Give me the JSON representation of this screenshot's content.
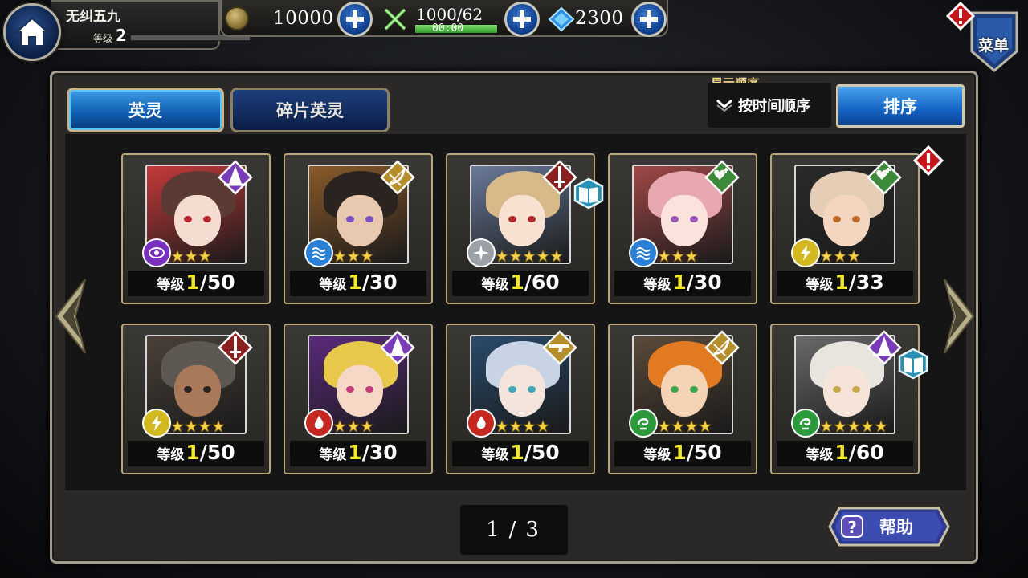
{
  "player": {
    "name": "无纠五九",
    "level_label": "等级",
    "level": "2"
  },
  "resources": {
    "coins": "10000",
    "stamina": "1000/62",
    "stamina_timer": "00:00",
    "gems": "2300"
  },
  "menu": {
    "label": "菜单"
  },
  "tabs": [
    {
      "label": "英灵",
      "active": true
    },
    {
      "label": "碎片英灵",
      "active": false
    }
  ],
  "sort": {
    "title": "显示顺序",
    "value": "按时间顺序",
    "button_label": "排序"
  },
  "level_label": "等级",
  "heroes": [
    {
      "class_icon": "mage-hat-icon",
      "class_color": "#7a3bb8",
      "element_icon": "eye-element-icon",
      "element_color": "#7b2fbf",
      "stars": 3,
      "level_cur": "1",
      "level_max": "/50",
      "hair": "#5a3a32",
      "skin": "#f5dcd0",
      "bg": "#c43a3a",
      "eye": "#b8262e",
      "extra_icon": null,
      "alert": false
    },
    {
      "class_icon": "bow-icon",
      "class_color": "#b58d2a",
      "element_icon": "water-element-icon",
      "element_color": "#2a7fd6",
      "stars": 3,
      "level_cur": "1",
      "level_max": "/30",
      "hair": "#2a2320",
      "skin": "#e8c9b0",
      "bg": "#8a5a2a",
      "eye": "#7b4fc4",
      "extra_icon": null,
      "alert": false
    },
    {
      "class_icon": "sword-icon",
      "class_color": "#8b1e1e",
      "element_icon": "light-element-icon",
      "element_color": "#9aa0a6",
      "stars": 5,
      "level_cur": "1",
      "level_max": "/60",
      "hair": "#d8b98a",
      "skin": "#f7e2d2",
      "bg": "#6a7a9a",
      "eye": "#b02a2a",
      "extra_icon": "book-icon",
      "alert": false
    },
    {
      "class_icon": "heal-icon",
      "class_color": "#3c8a3a",
      "element_icon": "water-element-icon",
      "element_color": "#2a7fd6",
      "stars": 3,
      "level_cur": "1",
      "level_max": "/30",
      "hair": "#e8a8b0",
      "skin": "#fbe2dc",
      "bg": "#a04848",
      "eye": "#9a5ab8",
      "extra_icon": null,
      "alert": false
    },
    {
      "class_icon": "heal-icon",
      "class_color": "#3c8a3a",
      "element_icon": "thunder-element-icon",
      "element_color": "#d4b820",
      "stars": 3,
      "level_cur": "1",
      "level_max": "/33",
      "hair": "#e6cdb6",
      "skin": "#f4d6c0",
      "bg": "#2a2a2a",
      "eye": "#c06a2a",
      "extra_icon": null,
      "alert": true
    },
    {
      "class_icon": "sword-icon",
      "class_color": "#8b1e1e",
      "element_icon": "thunder-element-icon",
      "element_color": "#d4b820",
      "stars": 4,
      "level_cur": "1",
      "level_max": "/50",
      "hair": "#5e5852",
      "skin": "#a87a5a",
      "bg": "#4a4038",
      "eye": "#2a2220",
      "extra_icon": null,
      "alert": false
    },
    {
      "class_icon": "mage-hat-icon",
      "class_color": "#7a3bb8",
      "element_icon": "fire-element-icon",
      "element_color": "#c42820",
      "stars": 3,
      "level_cur": "1",
      "level_max": "/30",
      "hair": "#e8c84a",
      "skin": "#f6d8c6",
      "bg": "#5a2a7a",
      "eye": "#c43a7a",
      "extra_icon": null,
      "alert": false
    },
    {
      "class_icon": "gun-icon",
      "class_color": "#b58d2a",
      "element_icon": "fire-element-icon",
      "element_color": "#c42820",
      "stars": 4,
      "level_cur": "1",
      "level_max": "/50",
      "hair": "#c8d4e6",
      "skin": "#f4e4dc",
      "bg": "#2a4a6a",
      "eye": "#3aa8b8",
      "extra_icon": null,
      "alert": false
    },
    {
      "class_icon": "bow-icon",
      "class_color": "#b58d2a",
      "element_icon": "wind-element-icon",
      "element_color": "#2c9a3a",
      "stars": 4,
      "level_cur": "1",
      "level_max": "/50",
      "hair": "#e27a22",
      "skin": "#f4d2b4",
      "bg": "#5a4a3a",
      "eye": "#3aa84a",
      "extra_icon": null,
      "alert": false
    },
    {
      "class_icon": "mage-hat-icon",
      "class_color": "#7a3bb8",
      "element_icon": "wind-element-icon",
      "element_color": "#2c9a3a",
      "stars": 5,
      "level_cur": "1",
      "level_max": "/60",
      "hair": "#e8e4de",
      "skin": "#f6e4d8",
      "bg": "#6a6a6a",
      "eye": "#c8a84a",
      "extra_icon": "book-icon",
      "alert": false
    }
  ],
  "pagination": {
    "current": "1",
    "separator": "/",
    "total": "3"
  },
  "help": {
    "label": "帮助"
  }
}
